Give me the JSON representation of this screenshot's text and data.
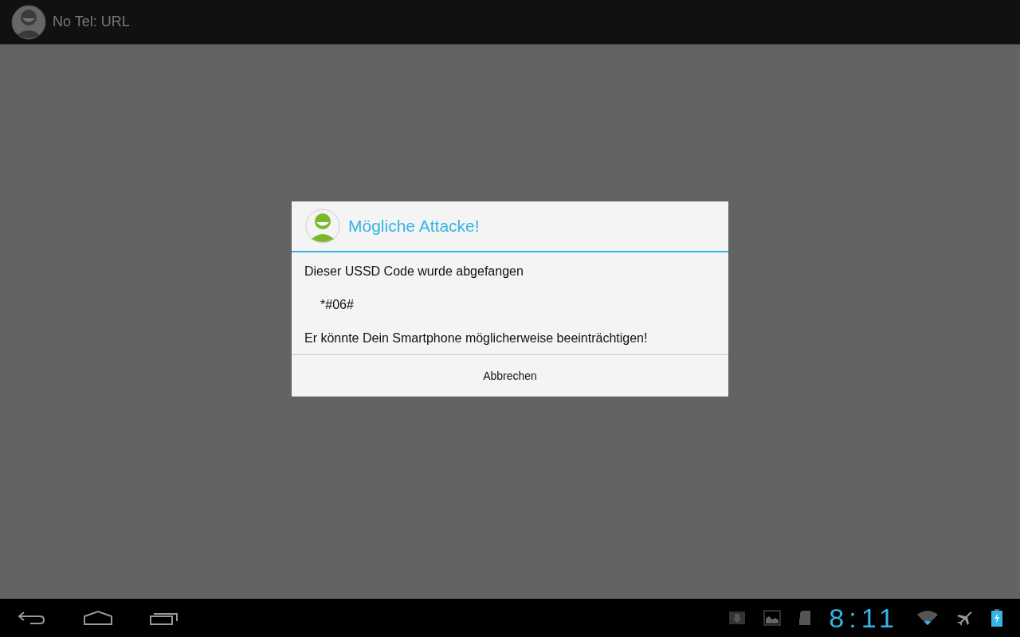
{
  "action_bar": {
    "title": "No Tel: URL"
  },
  "dialog": {
    "title": "Mögliche Attacke!",
    "message": "Dieser USSD Code wurde abgefangen",
    "code": "*#06#",
    "warning": "Er könnte Dein Smartphone möglicherweise beeinträchtigen!",
    "buttons": [
      "Abbrechen"
    ]
  },
  "system_bar": {
    "clock": "8:11"
  }
}
